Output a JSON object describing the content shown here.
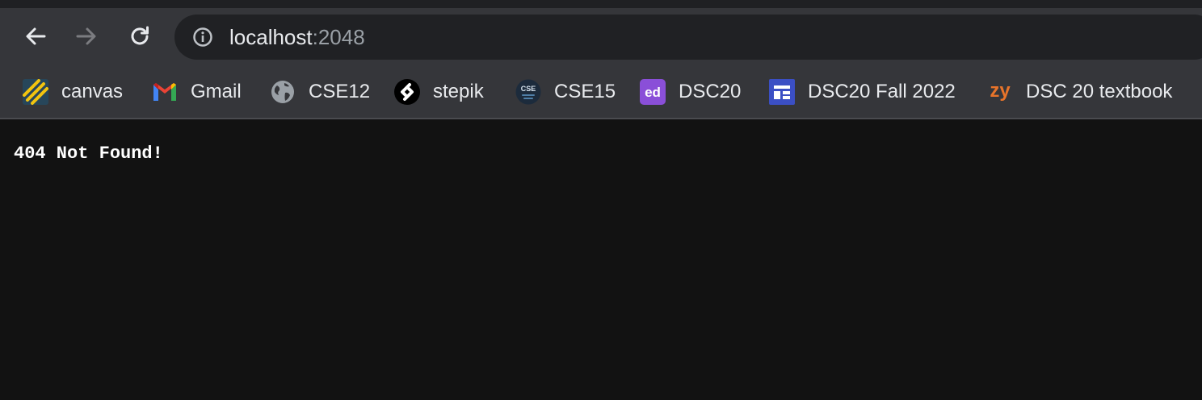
{
  "browser": {
    "url_host": "localhost",
    "url_port": ":2048",
    "nav": {
      "back_icon": "arrow-left-icon",
      "forward_icon": "arrow-right-icon",
      "reload_icon": "reload-icon",
      "info_icon": "info-icon"
    }
  },
  "bookmarks": [
    {
      "label": "canvas",
      "icon": "canvas-icon"
    },
    {
      "label": "Gmail",
      "icon": "gmail-icon"
    },
    {
      "label": "CSE12",
      "icon": "globe-icon"
    },
    {
      "label": "stepik",
      "icon": "stepik-icon"
    },
    {
      "label": "CSE15",
      "icon": "cse-logo-icon",
      "icon_text": "CSE"
    },
    {
      "label": "DSC20",
      "icon": "ed-icon",
      "icon_text": "ed"
    },
    {
      "label": "DSC20 Fall 2022",
      "icon": "layout-icon"
    },
    {
      "label": "DSC 20 textbook",
      "icon": "zybooks-icon",
      "icon_text": "zy"
    }
  ],
  "page": {
    "message": "404 Not Found!"
  },
  "colors": {
    "toolbar": "#35363a",
    "omnibox": "#202124",
    "page_background": "#121212",
    "text": "#e8eaed",
    "muted": "#9aa0a6"
  }
}
